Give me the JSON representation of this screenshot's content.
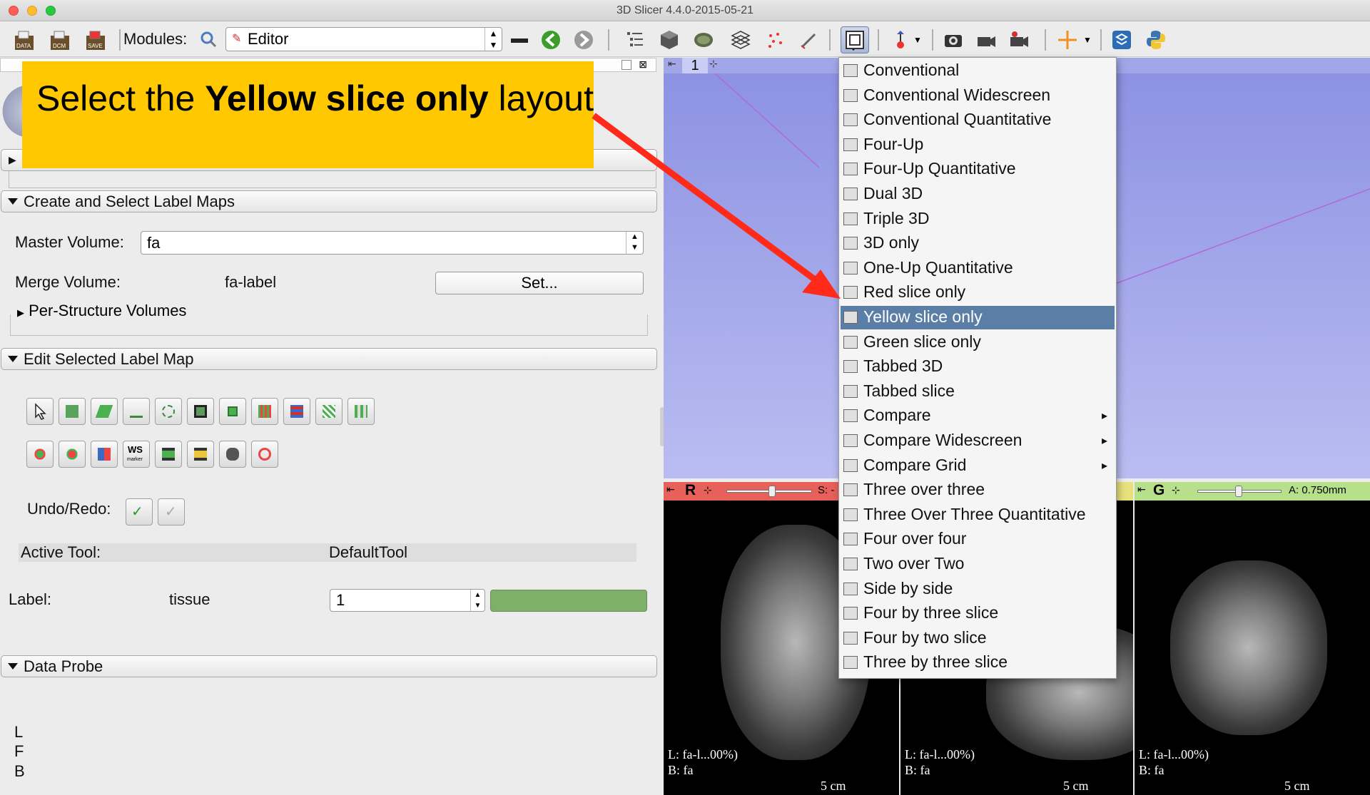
{
  "window": {
    "title": "3D Slicer 4.4.0-2015-05-21"
  },
  "toolbar": {
    "data_label": "DATA",
    "dcm_label": "DCM",
    "save_label": "SAVE",
    "modules_label": "Modules:",
    "module_value": "Editor"
  },
  "callout": {
    "prefix": "Select the ",
    "bold": "Yellow slice only",
    "suffix": " layout"
  },
  "panel": {
    "section_collapsed_hidden": "",
    "create_section": "Create and Select Label Maps",
    "master_volume_label": "Master Volume:",
    "master_volume_value": "fa",
    "merge_volume_label": "Merge Volume:",
    "merge_volume_value": "fa-label",
    "set_button": "Set...",
    "per_structure": "Per-Structure Volumes",
    "edit_section": "Edit Selected Label Map",
    "ws_label": "WS",
    "undo_redo_label": "Undo/Redo:",
    "active_tool_label": "Active Tool:",
    "active_tool_value": "DefaultTool",
    "label_label": "Label:",
    "label_name": "tissue",
    "label_value": "1",
    "label_color": "#7fb06a",
    "data_probe": "Data Probe",
    "probe_l": "L",
    "probe_f": "F",
    "probe_b": "B"
  },
  "views": {
    "view3d_number": "1",
    "red_letter": "R",
    "red_offset": "S: -",
    "green_letter": "G",
    "green_offset": "A: 0.750mm",
    "red_info_l": "L: fa-l...00%)",
    "red_info_b": "B: fa",
    "yellow_info_l": "L: fa-l...00%)",
    "yellow_info_b": "B: fa",
    "green_info_l": "L: fa-l...00%)",
    "green_info_b": "B: fa",
    "scale": "5 cm"
  },
  "layout_menu": {
    "items": [
      {
        "label": "Conventional",
        "sub": ""
      },
      {
        "label": "Conventional Widescreen",
        "sub": ""
      },
      {
        "label": "Conventional Quantitative",
        "sub": ""
      },
      {
        "label": "Four-Up",
        "sub": ""
      },
      {
        "label": "Four-Up Quantitative",
        "sub": ""
      },
      {
        "label": "Dual 3D",
        "sub": ""
      },
      {
        "label": "Triple 3D",
        "sub": ""
      },
      {
        "label": "3D only",
        "sub": ""
      },
      {
        "label": "One-Up Quantitative",
        "sub": ""
      },
      {
        "label": "Red slice only",
        "sub": ""
      },
      {
        "label": "Yellow slice only",
        "sub": ""
      },
      {
        "label": "Green slice only",
        "sub": ""
      },
      {
        "label": "Tabbed 3D",
        "sub": ""
      },
      {
        "label": "Tabbed slice",
        "sub": ""
      },
      {
        "label": "Compare",
        "sub": "▸"
      },
      {
        "label": "Compare Widescreen",
        "sub": "▸"
      },
      {
        "label": "Compare Grid",
        "sub": "▸"
      },
      {
        "label": "Three over three",
        "sub": ""
      },
      {
        "label": "Three Over Three Quantitative",
        "sub": ""
      },
      {
        "label": "Four over four",
        "sub": ""
      },
      {
        "label": "Two over Two",
        "sub": ""
      },
      {
        "label": "Side by side",
        "sub": ""
      },
      {
        "label": "Four by three slice",
        "sub": ""
      },
      {
        "label": "Four by two slice",
        "sub": ""
      },
      {
        "label": "Three by three slice",
        "sub": ""
      }
    ],
    "selected_index": 10
  },
  "colors": {
    "red_bar": "#e8605a",
    "yellow_bar": "#e8e07a",
    "green_bar": "#b6e08a",
    "accent": "#5b7ea6",
    "callout": "#ffc800",
    "arrow": "#ff2a1a"
  }
}
